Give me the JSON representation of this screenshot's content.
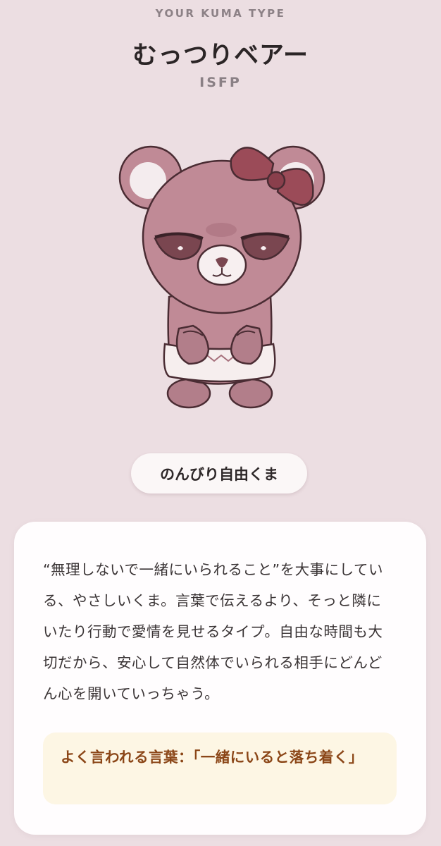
{
  "header": {
    "eyebrow": "YOUR KUMA TYPE",
    "title": "むっつりベアー",
    "mbti": "ISFP"
  },
  "character": {
    "illustration": "pink-bear-with-ribbon",
    "colors": {
      "bear_body": "#c08a96",
      "bear_shade": "#a6707c",
      "ribbon": "#9b4b58",
      "outline": "#4a2c33"
    }
  },
  "tag": {
    "label": "のんびり自由くま"
  },
  "card": {
    "description": "“無理しないで一緒にいられること”を大事にしている、やさしいくま。言葉で伝えるより、そっと隣にいたり行動で愛情を見せるタイプ。自由な時間も大切だから、安心して自然体でいられる相手にどんどん心を開いていっちゃう。",
    "quote": "よく言われる言葉：「一緒にいると落ち着く」"
  },
  "colors": {
    "background": "#ecdee2",
    "card": "#fffdfe",
    "quote_bg": "#fdf6e4",
    "quote_text": "#8b4617"
  }
}
